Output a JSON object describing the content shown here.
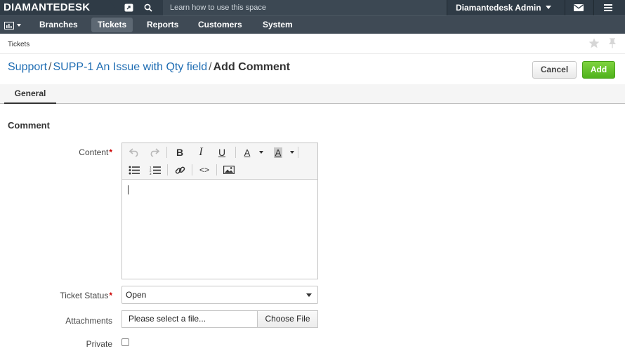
{
  "app": {
    "logo": "DIAMANTEDESK"
  },
  "topbar": {
    "search_placeholder": "Learn how to use this space",
    "user_name": "Diamantedesk Admin"
  },
  "nav": {
    "items": [
      {
        "label": "Branches"
      },
      {
        "label": "Tickets"
      },
      {
        "label": "Reports"
      },
      {
        "label": "Customers"
      },
      {
        "label": "System"
      }
    ],
    "active": "Tickets"
  },
  "breadcrumb": {
    "small": "Tickets",
    "parts": [
      "Support",
      "SUPP-1 An Issue with Qty field"
    ],
    "current": "Add Comment"
  },
  "actions": {
    "cancel": "Cancel",
    "add": "Add"
  },
  "tabs": [
    {
      "label": "General"
    }
  ],
  "form": {
    "section_title": "Comment",
    "content_label": "Content",
    "status_label": "Ticket Status",
    "status_value": "Open",
    "attachments_label": "Attachments",
    "file_placeholder": "Please select a file...",
    "choose_file": "Choose File",
    "private_label": "Private",
    "private_checked": false
  },
  "editor_toolbar": {
    "bold": "B",
    "italic": "I",
    "underline": "U",
    "font_color": "A",
    "bg_color": "A",
    "code": "<>"
  },
  "colors": {
    "topbar": "#2f3b46",
    "navbar": "#3f4a55",
    "link": "#1f6db3",
    "add_button": "#5cbd24",
    "required": "#cc0000"
  }
}
